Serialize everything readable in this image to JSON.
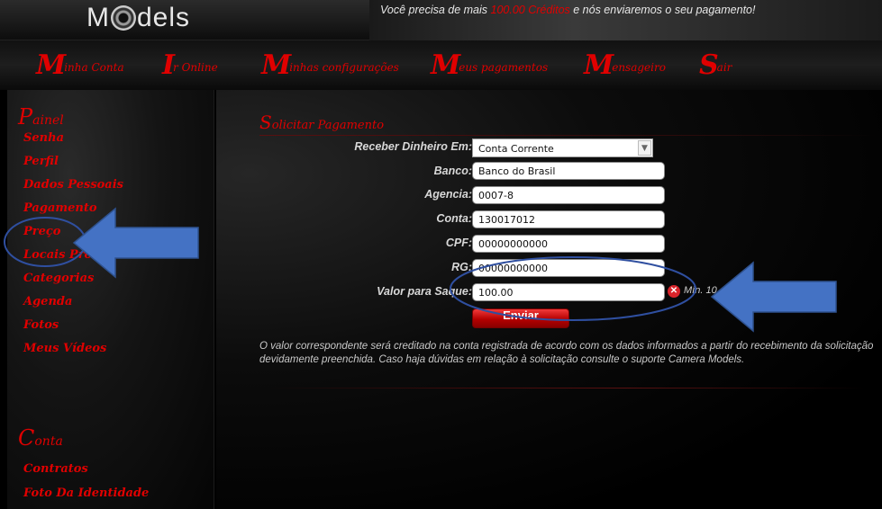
{
  "header": {
    "logo_left": "M",
    "logo_right": "dels",
    "promo_prefix": "Você precisa de mais ",
    "promo_credit": "100.00 Créditos",
    "promo_suffix": " e nós enviaremos o seu pagamento!"
  },
  "nav": [
    {
      "cap": "M",
      "rest": "inha Conta"
    },
    {
      "cap": "I",
      "rest": "r Online"
    },
    {
      "cap": "M",
      "rest": "inhas configurações"
    },
    {
      "cap": "M",
      "rest": "eus pagamentos"
    },
    {
      "cap": "M",
      "rest": "ensageiro"
    },
    {
      "cap": "S",
      "rest": "air"
    }
  ],
  "sidebar": {
    "painel_title_cap": "P",
    "painel_title_rest": "ainel",
    "painel_items": [
      "Senha",
      "Perfil",
      "Dados Pessoais",
      "Pagamento",
      "Preço",
      "Locais Proibidos",
      "Categorias",
      "Agenda",
      "Fotos",
      "Meus Vídeos"
    ],
    "conta_title_cap": "C",
    "conta_title_rest": "onta",
    "conta_items": [
      "Contratos",
      "Foto Da Identidade"
    ]
  },
  "form": {
    "title_cap": "S",
    "title_rest": "olicitar Pagamento",
    "receber_label": "Receber Dinheiro Em:",
    "receber_value": "Conta Corrente",
    "banco_label": "Banco:",
    "banco_value": "Banco do Brasil",
    "agencia_label": "Agencia:",
    "agencia_value": "0007-8",
    "conta_label": "Conta:",
    "conta_value": "130017012",
    "cpf_label": "CPF:",
    "cpf_value": "00000000000",
    "rg_label": "RG:",
    "rg_value": "00000000000",
    "valor_label": "Valor para Saque:",
    "valor_value": "100.00",
    "min_note": "Mín. 10",
    "submit_label": "Enviar",
    "note": "O valor correspondente será creditado na conta registrada de acordo com os dados informados a partir do recebimento da solicitação devidamente preenchida. Caso haja dúvidas em relação à solicitação consulte o suporte Camera Models."
  },
  "colors": {
    "accent_red": "#e00000",
    "annotation_blue": "#4472c4",
    "annotation_ellipse": "#2f4fa0"
  },
  "annotations": {
    "icons": [
      "arrow-left-icon",
      "ellipse-highlight-icon"
    ]
  }
}
